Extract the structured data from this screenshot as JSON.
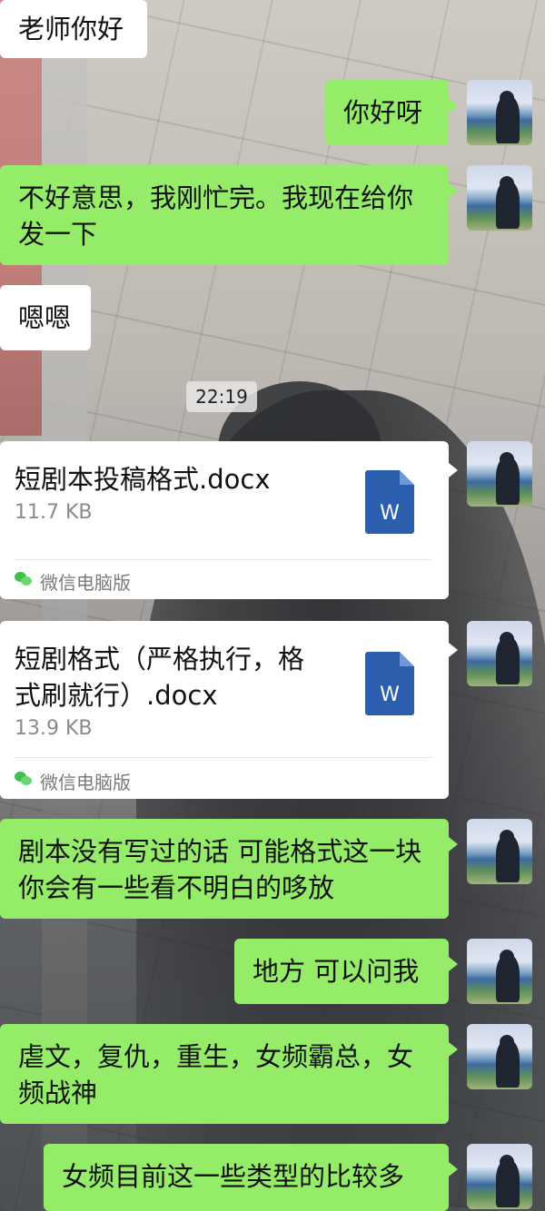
{
  "messages": [
    {
      "lines": [
        "老师你好"
      ]
    },
    {
      "lines": [
        "你好呀"
      ]
    },
    {
      "lines": [
        "不好意思，我刚忙完。我现在给你",
        "发一下"
      ]
    },
    {
      "lines": [
        "嗯嗯"
      ]
    },
    {
      "lines": [
        "剧本没有写过的话 可能格式这一块",
        "你会有一些看不明白的哆放"
      ]
    },
    {
      "lines": [
        "地方 可以问我"
      ]
    },
    {
      "lines": [
        "虐文，复仇，重生，女频霸总，女",
        "频战神"
      ]
    },
    {
      "lines": [
        "女频目前这一些类型的比较多"
      ]
    }
  ],
  "timestamp": "22:19",
  "files": [
    {
      "name_lines": [
        "短剧本投稿格式.docx"
      ],
      "size": "11.7 KB",
      "source": "微信电脑版",
      "icon_letter": "W"
    },
    {
      "name_lines": [
        "短剧格式（严格执行，格",
        "式刷就行）.docx"
      ],
      "size": "13.9 KB",
      "source": "微信电脑版",
      "icon_letter": "W"
    }
  ],
  "colors": {
    "outgoing": "#95ec69",
    "incoming": "#ffffff",
    "word": "#2b5fad"
  }
}
